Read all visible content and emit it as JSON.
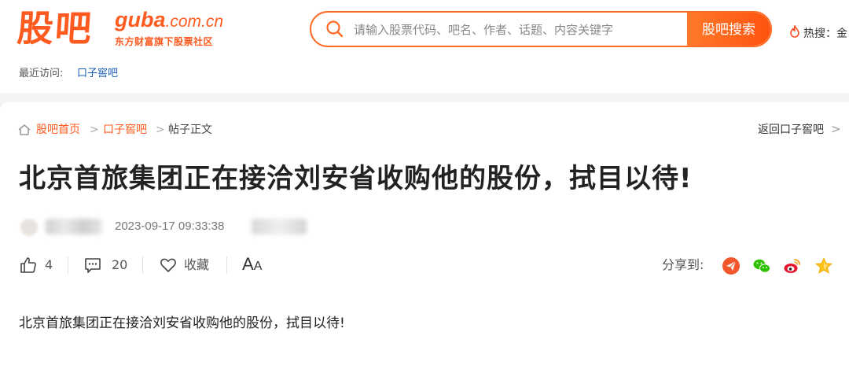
{
  "header": {
    "logo_cn": "股吧",
    "logo_en": "guba",
    "logo_domain": ".com.cn",
    "logo_sub": "东方财富旗下股票社区",
    "search": {
      "placeholder": "请输入股票代码、吧名、作者、话题、内容关键字",
      "value": "",
      "button_label": "股吧搜索"
    },
    "hot_label": "热搜：",
    "hot_item": "金",
    "recent_label": "最近访问:",
    "recent_link": "口子窖吧"
  },
  "breadcrumb": {
    "items": [
      "股吧首页",
      "口子窖吧",
      "帖子正文"
    ],
    "separator": ">",
    "back_link": "返回口子窖吧",
    "back_chevron": ">"
  },
  "post": {
    "title": "北京首旅集团正在接洽刘安省收购他的股份，拭目以待!",
    "post_time": "2023-09-17 09:33:38",
    "body": "北京首旅集团正在接洽刘安省收购他的股份，拭目以待!"
  },
  "actions": {
    "like_count": "4",
    "comment_count": "20",
    "favorite_label": "收藏",
    "font_size_big": "A",
    "font_size_small": "A",
    "share_label": "分享到:"
  },
  "colors": {
    "brand_orange": "#ff5a1f",
    "link_blue": "#1a5fb4",
    "page_background": "#f4f4f6"
  },
  "icons": [
    "search-icon",
    "hot-fire-icon",
    "home-icon",
    "like-icon",
    "comment-icon",
    "favorite-heart-icon",
    "share-paper-plane-icon",
    "share-wechat-icon",
    "share-weibo-icon",
    "share-star-icon"
  ]
}
